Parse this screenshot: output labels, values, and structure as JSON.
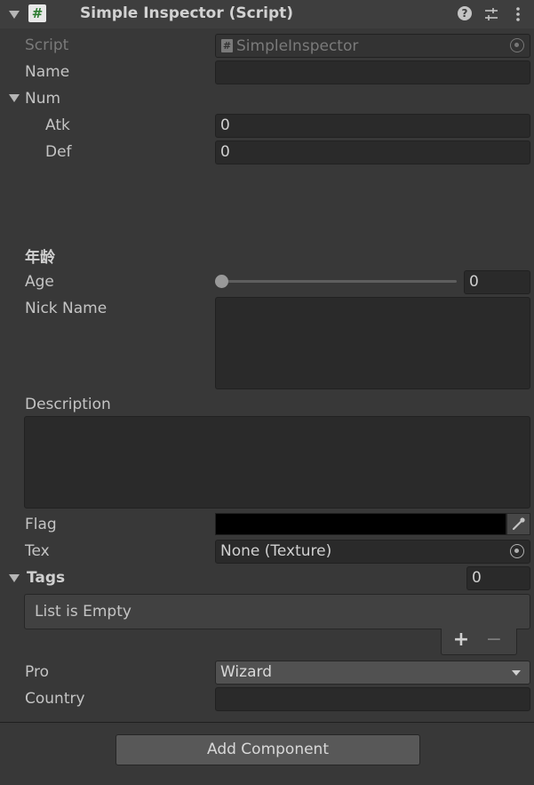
{
  "header": {
    "title": "Simple Inspector (Script)",
    "script_icon": "#",
    "help_icon": "?",
    "presets_icon": "sliders-icon",
    "menu_icon": "kebab-menu-icon"
  },
  "fields": {
    "script": {
      "label": "Script",
      "value": "SimpleInspector",
      "icon": "#"
    },
    "name": {
      "label": "Name",
      "value": ""
    },
    "num": {
      "label": "Num",
      "atk": {
        "label": "Atk",
        "value": "0"
      },
      "def": {
        "label": "Def",
        "value": "0"
      }
    },
    "section_header": "年龄",
    "age": {
      "label": "Age",
      "value": "0",
      "slider_fraction": 0
    },
    "nick_name": {
      "label": "Nick Name",
      "value": ""
    },
    "description": {
      "label": "Description",
      "value": ""
    },
    "flag": {
      "label": "Flag",
      "color": "#000000"
    },
    "tex": {
      "label": "Tex",
      "value": "None (Texture)"
    },
    "tags": {
      "label": "Tags",
      "count": "0",
      "empty_text": "List is Empty",
      "add": "+",
      "remove": "−"
    },
    "pro": {
      "label": "Pro",
      "value": "Wizard"
    },
    "country": {
      "label": "Country",
      "value": ""
    }
  },
  "add_component": {
    "label": "Add Component"
  },
  "colors": {
    "background": "#383838",
    "field": "#2a2a2a",
    "header": "#3e3e3e"
  }
}
